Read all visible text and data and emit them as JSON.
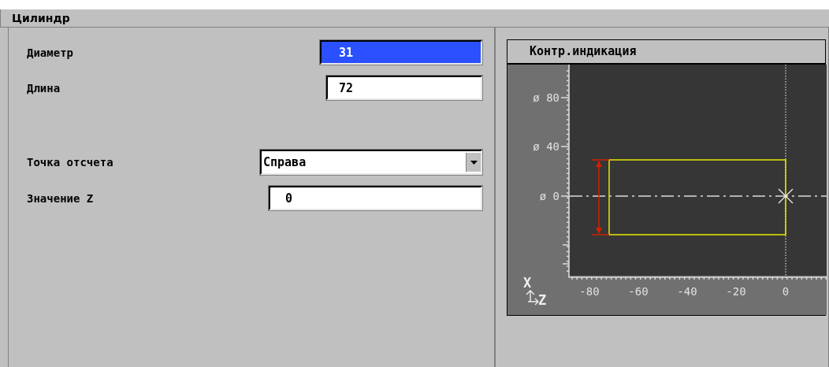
{
  "window": {
    "title": "Цилиндр"
  },
  "fields": [
    {
      "kind": "input",
      "label": "Диаметр",
      "value": "31",
      "selected": true
    },
    {
      "kind": "input",
      "label": "Длина",
      "value": "72",
      "selected": false
    },
    {
      "kind": "dropdown",
      "label": "Точка отсчета",
      "value": "Справа",
      "selected": false
    },
    {
      "kind": "input",
      "label": "Значение Z",
      "value": "0",
      "selected": false
    }
  ],
  "preview": {
    "title": "Контр.индикация",
    "y_ticks": [
      "ø 80",
      "ø 40",
      "ø 0"
    ],
    "x_ticks": [
      "-80",
      "-60",
      "-40",
      "-20",
      "0"
    ],
    "axis_x": "X",
    "axis_z": "Z"
  }
}
